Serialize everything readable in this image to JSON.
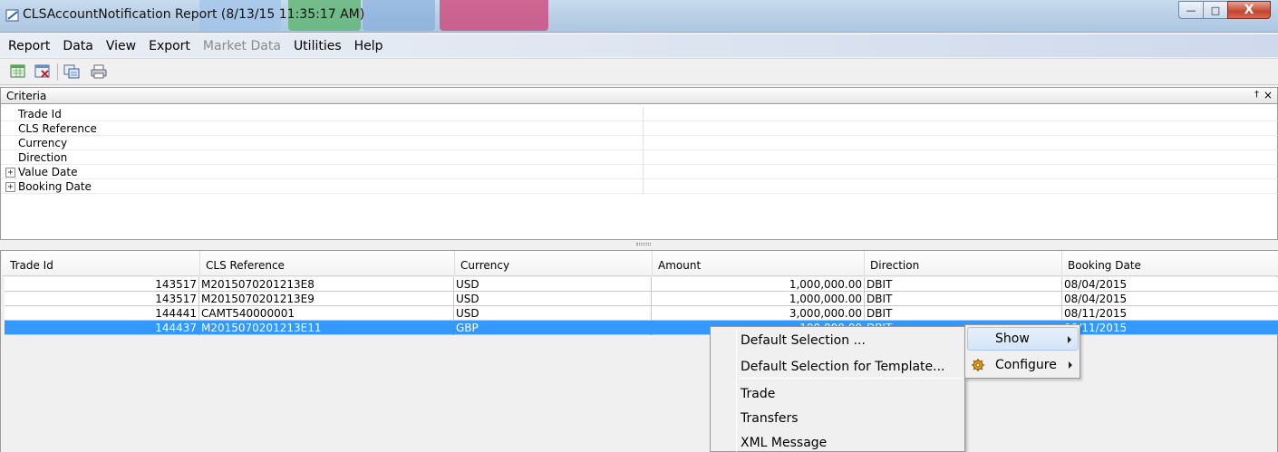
{
  "window": {
    "title": "CLSAccountNotification Report (8/13/15 11:35:17 AM)",
    "minimize_glyph": "—",
    "maximize_glyph": "□",
    "close_glyph": "X"
  },
  "menubar": {
    "items": [
      {
        "label": "Report",
        "enabled": true
      },
      {
        "label": "Data",
        "enabled": true
      },
      {
        "label": "View",
        "enabled": true
      },
      {
        "label": "Export",
        "enabled": true
      },
      {
        "label": "Market Data",
        "enabled": false
      },
      {
        "label": "Utilities",
        "enabled": true
      },
      {
        "label": "Help",
        "enabled": true
      }
    ]
  },
  "toolbar": {
    "icons": [
      "load-report-icon",
      "delete-report-icon",
      "copy-report-icon",
      "print-icon"
    ]
  },
  "criteria": {
    "title": "Criteria",
    "pin_glyph": "†",
    "close_glyph": "×",
    "rows": [
      {
        "label": "Trade Id",
        "expandable": false
      },
      {
        "label": "CLS Reference",
        "expandable": false
      },
      {
        "label": "Currency",
        "expandable": false
      },
      {
        "label": "Direction",
        "expandable": false
      },
      {
        "label": "Value Date",
        "expandable": true
      },
      {
        "label": "Booking Date",
        "expandable": true
      }
    ],
    "expander_glyph": "+"
  },
  "grid": {
    "columns": [
      "Trade Id",
      "CLS Reference",
      "Currency",
      "Amount",
      "Direction",
      "Booking Date"
    ],
    "rows": [
      {
        "trade_id": "143517",
        "cls_reference": "M2015070201213E8",
        "currency": "USD",
        "amount": "1,000,000.00",
        "direction": "DBIT",
        "booking_date": "08/04/2015",
        "selected": false
      },
      {
        "trade_id": "143517",
        "cls_reference": "M2015070201213E9",
        "currency": "USD",
        "amount": "1,000,000.00",
        "direction": "DBIT",
        "booking_date": "08/04/2015",
        "selected": false
      },
      {
        "trade_id": "144441",
        "cls_reference": "CAMT540000001",
        "currency": "USD",
        "amount": "3,000,000.00",
        "direction": "DBIT",
        "booking_date": "08/11/2015",
        "selected": false
      },
      {
        "trade_id": "144437",
        "cls_reference": "M2015070201213E11",
        "currency": "GBP",
        "amount": "100,000.00",
        "direction": "DBIT",
        "booking_date": "08/11/2015",
        "selected": true
      }
    ]
  },
  "context_menu": {
    "items": [
      "Default Selection ...",
      "Default Selection for Template...",
      "Trade",
      "Transfers",
      "XML Message"
    ]
  },
  "submenu": {
    "items": [
      {
        "label": "Show",
        "highlighted": true,
        "icon": null
      },
      {
        "label": "Configure",
        "highlighted": false,
        "icon": "gear-icon"
      }
    ]
  },
  "colors": {
    "selection": "#3399ff",
    "titlebar": "#b8cfe6"
  }
}
